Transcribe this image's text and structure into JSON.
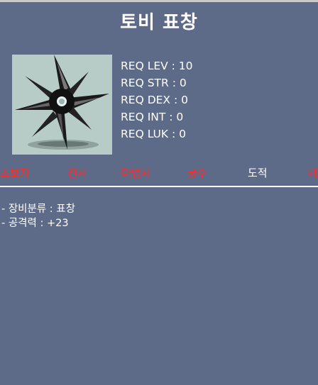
{
  "item": {
    "name": "토비 표창",
    "icon": "throwing-star-icon"
  },
  "requirements": [
    {
      "text": "REQ LEV : 10"
    },
    {
      "text": "REQ STR : 0"
    },
    {
      "text": "REQ DEX : 0"
    },
    {
      "text": "REQ INT : 0"
    },
    {
      "text": "REQ LUK : 0"
    }
  ],
  "jobs": [
    {
      "label": "초보자",
      "status": "unavailable"
    },
    {
      "label": "전사",
      "status": "unavailable"
    },
    {
      "label": "마법사",
      "status": "unavailable"
    },
    {
      "label": "궁수",
      "status": "unavailable"
    },
    {
      "label": "도적",
      "status": "available"
    },
    {
      "label": "해",
      "status": "unavailable"
    }
  ],
  "stats": [
    {
      "text": "- 장비분류 : 표창"
    },
    {
      "text": "- 공격력 : +23"
    }
  ],
  "colors": {
    "background": "#5e6b88",
    "unavailable_job": "#ff2a2a",
    "available_job": "#ffffff",
    "icon_bg": "#b8ccc7"
  }
}
